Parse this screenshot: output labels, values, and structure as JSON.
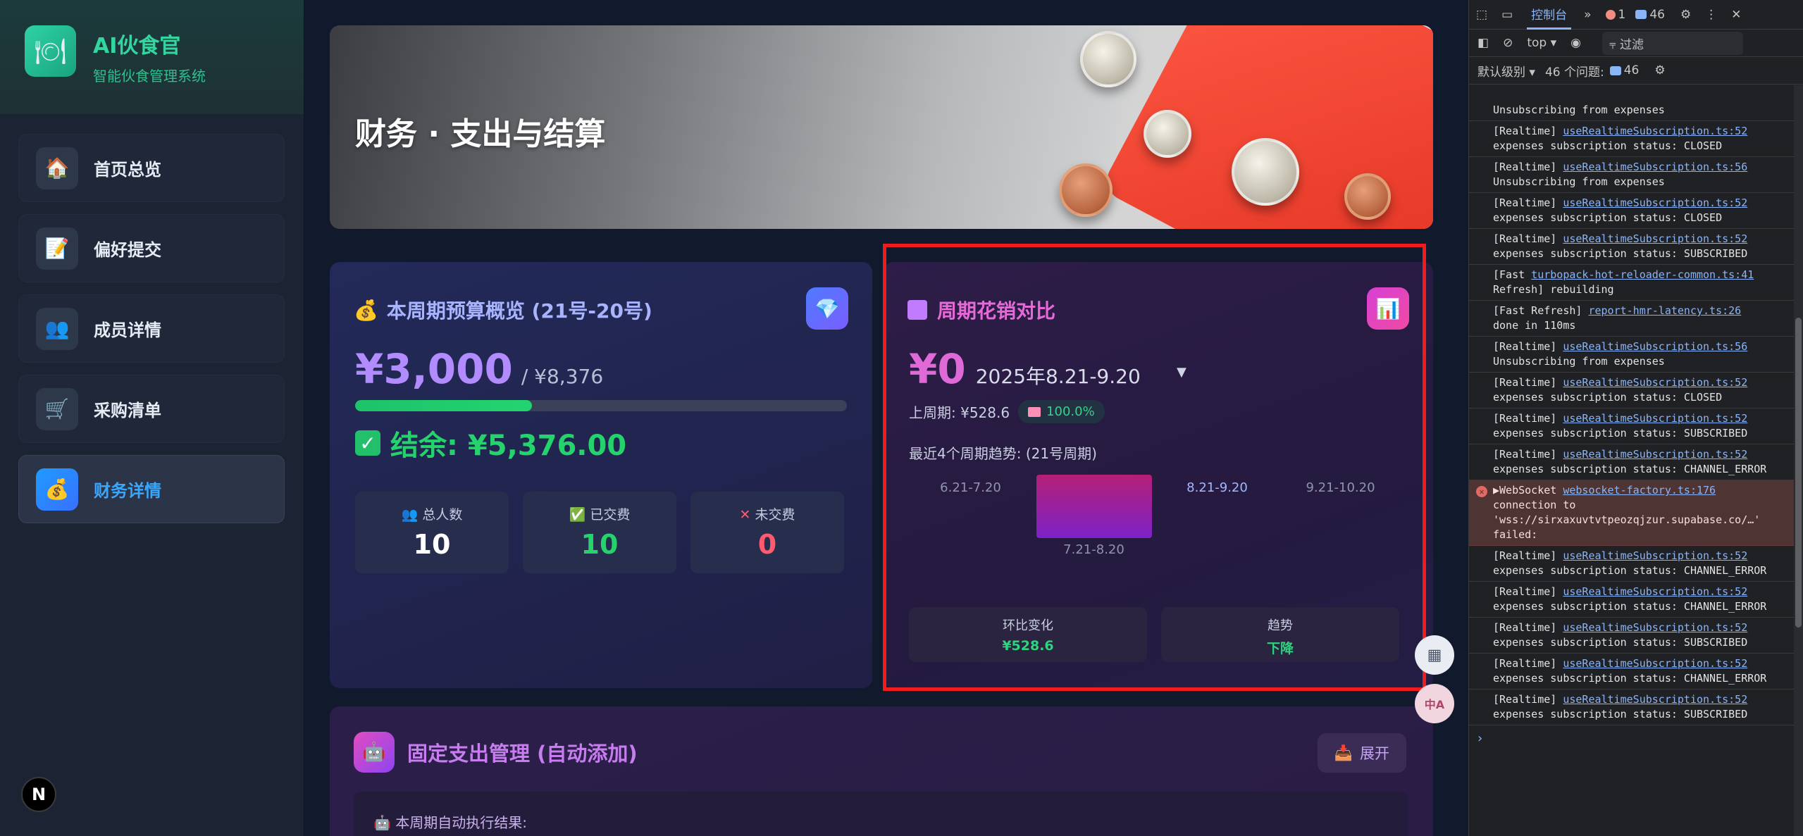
{
  "brand": {
    "logo_icon": "plate-icon",
    "title": "AI伙食官",
    "subtitle": "智能伙食管理系统"
  },
  "sidebar": {
    "items": [
      {
        "label": "首页总览",
        "icon": "house-icon",
        "active": false
      },
      {
        "label": "偏好提交",
        "icon": "form-icon",
        "active": false
      },
      {
        "label": "成员详情",
        "icon": "users-icon",
        "active": false
      },
      {
        "label": "采购清单",
        "icon": "cart-icon",
        "active": false
      },
      {
        "label": "财务详情",
        "icon": "money-bag-icon",
        "active": true
      }
    ],
    "next_badge": "N"
  },
  "hero": {
    "title": "财务 · 支出与结算"
  },
  "budget": {
    "title": "本周期预算概览 (21号-20号)",
    "amount": "¥3,000",
    "total": "/ ¥8,376",
    "progress_fraction": 0.36,
    "remaining": "结余: ¥5,376.00",
    "stats": [
      {
        "label": "总人数",
        "value": "10",
        "color": "#ffffff",
        "icon": "people-icon"
      },
      {
        "label": "已交费",
        "value": "10",
        "color": "#24d36b",
        "icon": "check-icon"
      },
      {
        "label": "未交费",
        "value": "0",
        "color": "#ff5a6e",
        "icon": "cross-icon"
      }
    ]
  },
  "period": {
    "title": "周期花销对比",
    "amount": "¥0",
    "range": "2025年8.21-9.20",
    "dropdown": "▼",
    "previous": "上周期: ¥528.6",
    "change_pct": "100.0%",
    "trend_label": "最近4个周期趋势: (21号周期)",
    "chart_data": {
      "type": "bar",
      "categories": [
        "6.21-7.20",
        "7.21-8.20",
        "8.21-9.20",
        "9.21-10.20"
      ],
      "values": [
        0,
        528.6,
        0,
        0
      ],
      "current": "8.21-9.20"
    },
    "boxes": [
      {
        "title": "环比变化",
        "value": "¥528.6"
      },
      {
        "title": "趋势",
        "value": "下降"
      }
    ]
  },
  "fixed": {
    "title": "固定支出管理 (自动添加)",
    "expand": "展开",
    "sub": "本周期自动执行结果:"
  },
  "floating": {
    "apps": "apps-icon",
    "translate": "中A"
  },
  "devtools": {
    "tab_console": "控制台",
    "error_count": "1",
    "message_count": "46",
    "context": "top",
    "filter": "过滤",
    "level": "默认级别",
    "issues": "46 个问题:",
    "issues_count": "46",
    "logs": [
      {
        "type": "log",
        "prefix": "",
        "link": "",
        "text": "Unsubscribing from expenses"
      },
      {
        "type": "log",
        "prefix": "[Realtime]",
        "link": "useRealtimeSubscription.ts:52",
        "text": "expenses subscription status: CLOSED"
      },
      {
        "type": "log",
        "prefix": "[Realtime]",
        "link": "useRealtimeSubscription.ts:56",
        "text": "Unsubscribing from expenses"
      },
      {
        "type": "log",
        "prefix": "[Realtime]",
        "link": "useRealtimeSubscription.ts:52",
        "text": "expenses subscription status: CLOSED"
      },
      {
        "type": "log",
        "prefix": "[Realtime]",
        "link": "useRealtimeSubscription.ts:52",
        "text": "expenses subscription status: SUBSCRIBED"
      },
      {
        "type": "log",
        "prefix": "[Fast",
        "link": "turbopack-hot-reloader-common.ts:41",
        "text": "Refresh] rebuilding"
      },
      {
        "type": "log",
        "prefix": "[Fast Refresh]",
        "link": "report-hmr-latency.ts:26",
        "text": "done in 110ms"
      },
      {
        "type": "log",
        "prefix": "[Realtime]",
        "link": "useRealtimeSubscription.ts:56",
        "text": "Unsubscribing from expenses"
      },
      {
        "type": "log",
        "prefix": "[Realtime]",
        "link": "useRealtimeSubscription.ts:52",
        "text": "expenses subscription status: CLOSED"
      },
      {
        "type": "log",
        "prefix": "[Realtime]",
        "link": "useRealtimeSubscription.ts:52",
        "text": "expenses subscription status: SUBSCRIBED"
      },
      {
        "type": "log",
        "prefix": "[Realtime]",
        "link": "useRealtimeSubscription.ts:52",
        "text": "expenses subscription status: CHANNEL_ERROR"
      },
      {
        "type": "error",
        "prefix": "▶WebSocket",
        "link": "websocket-factory.ts:176",
        "text": "connection to 'wss://sirxaxuvtvtpeozqjzur.supabase.co/…' failed:"
      },
      {
        "type": "log",
        "prefix": "[Realtime]",
        "link": "useRealtimeSubscription.ts:52",
        "text": "expenses subscription status: CHANNEL_ERROR"
      },
      {
        "type": "log",
        "prefix": "[Realtime]",
        "link": "useRealtimeSubscription.ts:52",
        "text": "expenses subscription status: CHANNEL_ERROR"
      },
      {
        "type": "log",
        "prefix": "[Realtime]",
        "link": "useRealtimeSubscription.ts:52",
        "text": "expenses subscription status: SUBSCRIBED"
      },
      {
        "type": "log",
        "prefix": "[Realtime]",
        "link": "useRealtimeSubscription.ts:52",
        "text": "expenses subscription status: CHANNEL_ERROR"
      },
      {
        "type": "log",
        "prefix": "[Realtime]",
        "link": "useRealtimeSubscription.ts:52",
        "text": "expenses subscription status: SUBSCRIBED"
      }
    ],
    "prompt": "›"
  }
}
